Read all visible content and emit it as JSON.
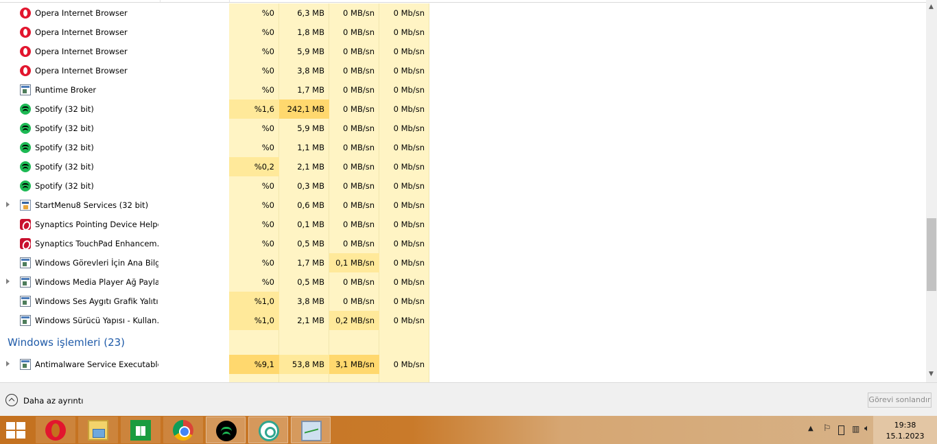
{
  "rows": [
    {
      "name": "Opera Internet Browser",
      "icon": "opera-icon",
      "expandable": false,
      "cpu": "%0",
      "memory": "6,3 MB",
      "disk": "0 MB/sn",
      "network": "0 Mb/sn"
    },
    {
      "name": "Opera Internet Browser",
      "icon": "opera-icon",
      "expandable": false,
      "cpu": "%0",
      "memory": "1,8 MB",
      "disk": "0 MB/sn",
      "network": "0 Mb/sn"
    },
    {
      "name": "Opera Internet Browser",
      "icon": "opera-icon",
      "expandable": false,
      "cpu": "%0",
      "memory": "5,9 MB",
      "disk": "0 MB/sn",
      "network": "0 Mb/sn"
    },
    {
      "name": "Opera Internet Browser",
      "icon": "opera-icon",
      "expandable": false,
      "cpu": "%0",
      "memory": "3,8 MB",
      "disk": "0 MB/sn",
      "network": "0 Mb/sn"
    },
    {
      "name": "Runtime Broker",
      "icon": "window-app-icon",
      "expandable": false,
      "cpu": "%0",
      "memory": "1,7 MB",
      "disk": "0 MB/sn",
      "network": "0 Mb/sn"
    },
    {
      "name": "Spotify (32 bit)",
      "icon": "spotify-icon",
      "expandable": false,
      "cpu": "%1,6",
      "memory": "242,1 MB",
      "disk": "0 MB/sn",
      "network": "0 Mb/sn"
    },
    {
      "name": "Spotify (32 bit)",
      "icon": "spotify-icon",
      "expandable": false,
      "cpu": "%0",
      "memory": "5,9 MB",
      "disk": "0 MB/sn",
      "network": "0 Mb/sn"
    },
    {
      "name": "Spotify (32 bit)",
      "icon": "spotify-icon",
      "expandable": false,
      "cpu": "%0",
      "memory": "1,1 MB",
      "disk": "0 MB/sn",
      "network": "0 Mb/sn"
    },
    {
      "name": "Spotify (32 bit)",
      "icon": "spotify-icon",
      "expandable": false,
      "cpu": "%0,2",
      "memory": "2,1 MB",
      "disk": "0 MB/sn",
      "network": "0 Mb/sn"
    },
    {
      "name": "Spotify (32 bit)",
      "icon": "spotify-icon",
      "expandable": false,
      "cpu": "%0",
      "memory": "0,3 MB",
      "disk": "0 MB/sn",
      "network": "0 Mb/sn"
    },
    {
      "name": "StartMenu8 Services (32 bit)",
      "icon": "startmenu-icon",
      "expandable": true,
      "cpu": "%0",
      "memory": "0,6 MB",
      "disk": "0 MB/sn",
      "network": "0 Mb/sn"
    },
    {
      "name": "Synaptics Pointing Device Helper",
      "icon": "synaptics-icon",
      "expandable": false,
      "cpu": "%0",
      "memory": "0,1 MB",
      "disk": "0 MB/sn",
      "network": "0 Mb/sn"
    },
    {
      "name": "Synaptics TouchPad Enhancem...",
      "icon": "synaptics-icon",
      "expandable": false,
      "cpu": "%0",
      "memory": "0,5 MB",
      "disk": "0 MB/sn",
      "network": "0 Mb/sn"
    },
    {
      "name": "Windows Görevleri İçin Ana Bilg...",
      "icon": "window-app-icon",
      "expandable": false,
      "cpu": "%0",
      "memory": "1,7 MB",
      "disk": "0,1 MB/sn",
      "network": "0 Mb/sn"
    },
    {
      "name": "Windows Media Player Ağ Payla...",
      "icon": "window-app-icon",
      "expandable": true,
      "cpu": "%0",
      "memory": "0,5 MB",
      "disk": "0 MB/sn",
      "network": "0 Mb/sn"
    },
    {
      "name": "Windows Ses Aygıtı Grafik Yalıtı...",
      "icon": "window-app-icon",
      "expandable": false,
      "cpu": "%1,0",
      "memory": "3,8 MB",
      "disk": "0 MB/sn",
      "network": "0 Mb/sn"
    },
    {
      "name": "Windows Sürücü Yapısı - Kullan...",
      "icon": "window-app-icon",
      "expandable": false,
      "cpu": "%1,0",
      "memory": "2,1 MB",
      "disk": "0,2 MB/sn",
      "network": "0 Mb/sn"
    }
  ],
  "group": {
    "title": "Windows işlemleri (23)"
  },
  "group_rows": [
    {
      "name": "Antimalware Service Executable",
      "icon": "window-app-icon",
      "expandable": true,
      "cpu": "%9,1",
      "memory": "53,8 MB",
      "disk": "3,1 MB/sn",
      "network": "0 Mb/sn"
    }
  ],
  "footer": {
    "fewer_details_label": "Daha az ayrıntı",
    "end_task_label": "Görevi sonlandır"
  },
  "taskbar": {
    "apps": [
      {
        "name": "opera-taskbar-icon",
        "state": "pinned"
      },
      {
        "name": "file-explorer-taskbar-icon",
        "state": "pinned"
      },
      {
        "name": "store-taskbar-icon",
        "state": "pinned"
      },
      {
        "name": "chrome-taskbar-icon",
        "state": "pinned"
      },
      {
        "name": "spotify-taskbar-icon",
        "state": "active"
      },
      {
        "name": "ccleaner-taskbar-icon",
        "state": "active"
      },
      {
        "name": "task-manager-taskbar-icon",
        "state": "active"
      }
    ],
    "time": "19:38",
    "date": "15.1.2023"
  },
  "colors": {
    "heat_low": "#fff4c4",
    "heat_mid": "#ffe99a",
    "heat_high": "#ffd86e",
    "group_title": "#1e5aa8",
    "taskbar": "#c4711f"
  }
}
